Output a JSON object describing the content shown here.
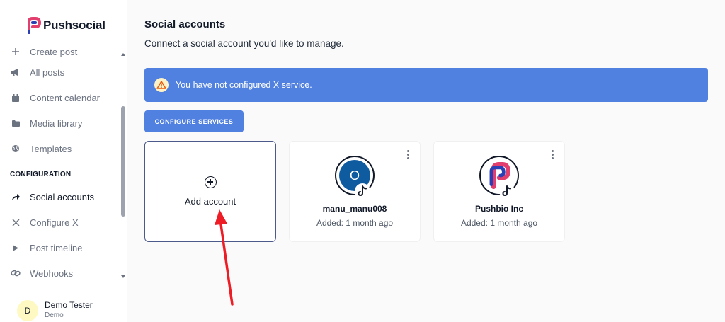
{
  "brand": {
    "name": "Pushsocial"
  },
  "sidebar": {
    "items": [
      {
        "label": "Create post",
        "icon": "plus-icon"
      },
      {
        "label": "All posts",
        "icon": "megaphone-icon"
      },
      {
        "label": "Content calendar",
        "icon": "calendar-icon"
      },
      {
        "label": "Media library",
        "icon": "folder-icon"
      },
      {
        "label": "Templates",
        "icon": "globe-icon"
      }
    ],
    "section_label": "CONFIGURATION",
    "config_items": [
      {
        "label": "Social accounts",
        "icon": "share-icon",
        "active": true
      },
      {
        "label": "Configure X",
        "icon": "x-icon"
      },
      {
        "label": "Post timeline",
        "icon": "play-icon"
      },
      {
        "label": "Webhooks",
        "icon": "link-icon"
      }
    ],
    "user": {
      "initial": "D",
      "name": "Demo Tester",
      "role": "Demo"
    }
  },
  "main": {
    "title": "Social accounts",
    "subtitle": "Connect a social account you'd like to manage.",
    "alert": {
      "text": "You have not configured X service.",
      "icon": "warning-icon"
    },
    "configure_button": "CONFIGURE SERVICES",
    "add_account_label": "Add account",
    "accounts": [
      {
        "name": "manu_manu008",
        "added": "Added: 1 month ago",
        "initial": "O",
        "avatar_color": "#0f5ba0",
        "platform": "tiktok-icon"
      },
      {
        "name": "Pushbio Inc",
        "added": "Added: 1 month ago",
        "platform": "tiktok-icon"
      }
    ]
  },
  "colors": {
    "accent": "#5080e0",
    "arrow": "#ee1c24"
  }
}
